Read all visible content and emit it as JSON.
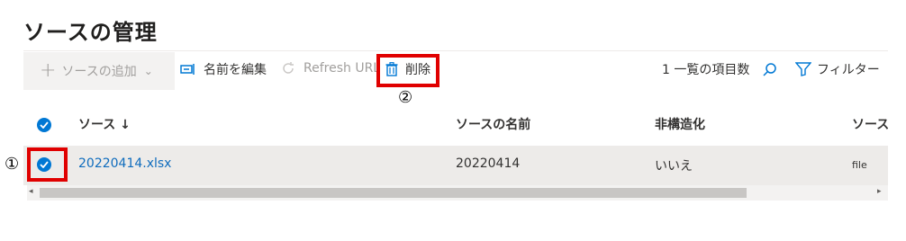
{
  "page": {
    "title": "ソースの管理"
  },
  "toolbar": {
    "add_label": "ソースの追加",
    "rename_label": "名前を編集",
    "refresh_label": "Refresh URL",
    "delete_label": "削除",
    "items_count_label": "1 一覧の項目数",
    "filter_label": "フィルター"
  },
  "annotations": {
    "marker_1": "①",
    "marker_2": "②"
  },
  "table": {
    "columns": [
      "ソース ↓",
      "ソースの名前",
      "非構造化",
      "ソース"
    ],
    "rows": [
      {
        "source": "20220414.xlsx",
        "source_name": "20220414",
        "unstructured": "いいえ",
        "type": "file",
        "selected": true
      }
    ]
  },
  "colors": {
    "accent": "#0078d4",
    "highlight": "#e00000",
    "row_selected": "#edebe9"
  }
}
